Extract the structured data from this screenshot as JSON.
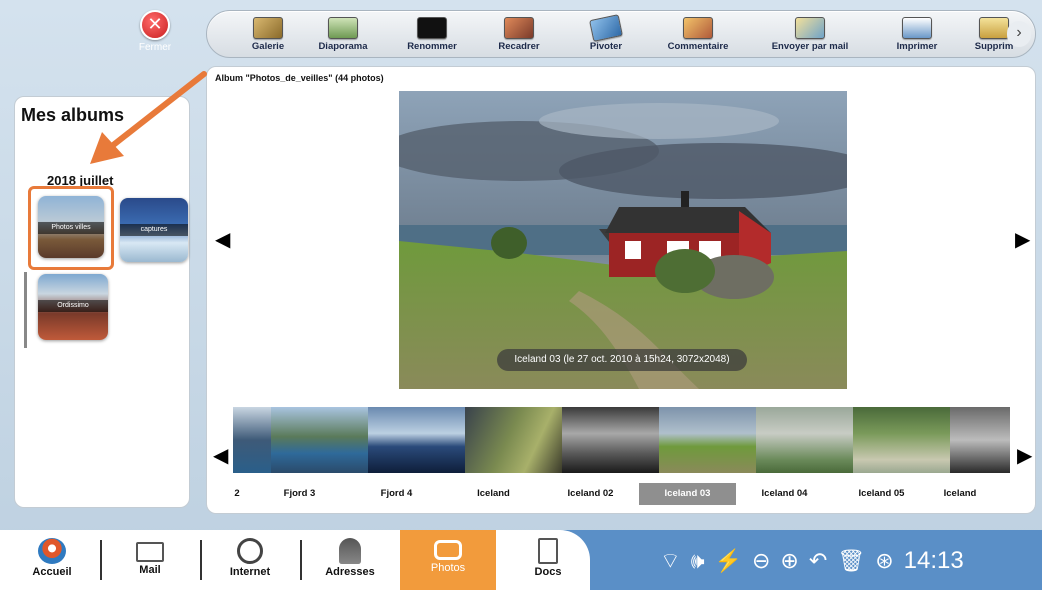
{
  "close": {
    "label": "Fermer"
  },
  "toolbar": {
    "items": [
      {
        "label": "Galerie",
        "icon": "gallery-icon",
        "color": "#c8a25a"
      },
      {
        "label": "Diaporama",
        "icon": "slideshow-icon",
        "color": "#7fae6a"
      },
      {
        "label": "Renommer",
        "icon": "rename-icon",
        "color": "#222222"
      },
      {
        "label": "Recadrer",
        "icon": "crop-icon",
        "color": "#c85a3a"
      },
      {
        "label": "Pivoter",
        "icon": "rotate-icon",
        "color": "#4a88c7"
      },
      {
        "label": "Commentaire",
        "icon": "comment-icon",
        "color": "#d9a04a"
      },
      {
        "label": "Envoyer par mail",
        "icon": "send-mail-icon",
        "color": "#6fa3c9"
      },
      {
        "label": "Imprimer",
        "icon": "print-icon",
        "color": "#6a98c8"
      },
      {
        "label": "Supprim",
        "icon": "delete-icon",
        "color": "#e0c060"
      }
    ],
    "more": "›"
  },
  "sidebar": {
    "title": "Mes albums",
    "year": "2018 juillet",
    "albums": [
      {
        "caption": "Photos villes"
      },
      {
        "caption": "captures"
      },
      {
        "caption": "Ordissimo"
      }
    ]
  },
  "viewer": {
    "header": "Album \"Photos_de_veilles\" (44 photos)",
    "caption": "Iceland 03 (le 27 oct. 2010 à 15h24, 3072x2048)",
    "prev": "◀",
    "next": "▶"
  },
  "filmstrip": {
    "labels": [
      "2",
      "Fjord 3",
      "Fjord 4",
      "Iceland",
      "Iceland 02",
      "Iceland 03",
      "Iceland 04",
      "Iceland 05",
      "Iceland"
    ],
    "selected_index": 5,
    "prev": "◀",
    "next": "▶"
  },
  "taskbar": {
    "items": [
      "Accueil",
      "Mail",
      "Internet",
      "Adresses",
      "Photos",
      "Docs"
    ],
    "active": "Photos",
    "clock": "14:13"
  },
  "colors": {
    "accent": "#f29b3c",
    "taskbar": "#5a8fc7",
    "selection": "#e87a3a"
  }
}
